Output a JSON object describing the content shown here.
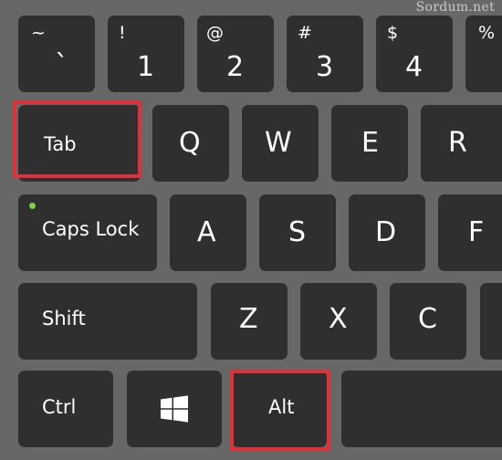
{
  "watermark": "Sordum.net",
  "colors": {
    "key": "#2f2f2f",
    "background": "#666767",
    "highlight": "#e0303a",
    "led": "#7bd24a"
  },
  "keyboard": {
    "row1": [
      {
        "shift": "~",
        "main": "`"
      },
      {
        "shift": "!",
        "main": "1"
      },
      {
        "shift": "@",
        "main": "2"
      },
      {
        "shift": "#",
        "main": "3"
      },
      {
        "shift": "$",
        "main": "4"
      },
      {
        "shift": "%",
        "main": ""
      }
    ],
    "tab": "Tab",
    "row2": [
      "Q",
      "W",
      "E",
      "R"
    ],
    "caps": "Caps Lock",
    "row3": [
      "A",
      "S",
      "D",
      "F"
    ],
    "shift": "Shift",
    "row4": [
      "Z",
      "X",
      "C"
    ],
    "ctrl": "Ctrl",
    "win_icon": "windows-logo-icon",
    "alt": "Alt"
  },
  "highlighted_keys": [
    "Tab",
    "Alt"
  ]
}
